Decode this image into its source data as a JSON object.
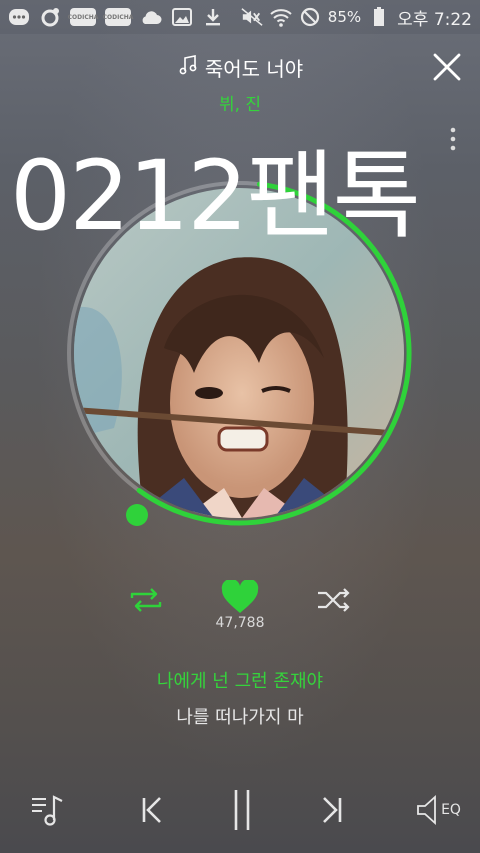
{
  "status_bar": {
    "tag_1": "CODICHA",
    "tag_2": "CODICHA",
    "battery": "85%",
    "time": "오후 7:22"
  },
  "header": {
    "song_title": "죽어도 너야",
    "artists": "뷔, 진"
  },
  "overlay_text": "0212팬톡",
  "album_art": {
    "progress_fraction": 0.66
  },
  "actions": {
    "like_count": "47,788"
  },
  "lyrics": {
    "current": "나에게 넌 그런 존재야",
    "next": "나를 떠나가지 마"
  },
  "bottom": {
    "eq_label": "EQ"
  },
  "colors": {
    "accent": "#2fd23a",
    "text": "#ffffff"
  },
  "icons": [
    "message-icon",
    "notification-icon",
    "cloud-icon",
    "gallery-icon",
    "download-icon",
    "mute-icon",
    "wifi-icon",
    "no-disturb-icon",
    "battery-icon",
    "music-note-icon",
    "close-icon",
    "more-vertical-icon",
    "repeat-icon",
    "heart-icon",
    "shuffle-icon",
    "playlist-icon",
    "previous-icon",
    "pause-icon",
    "next-icon",
    "equalizer-icon"
  ]
}
